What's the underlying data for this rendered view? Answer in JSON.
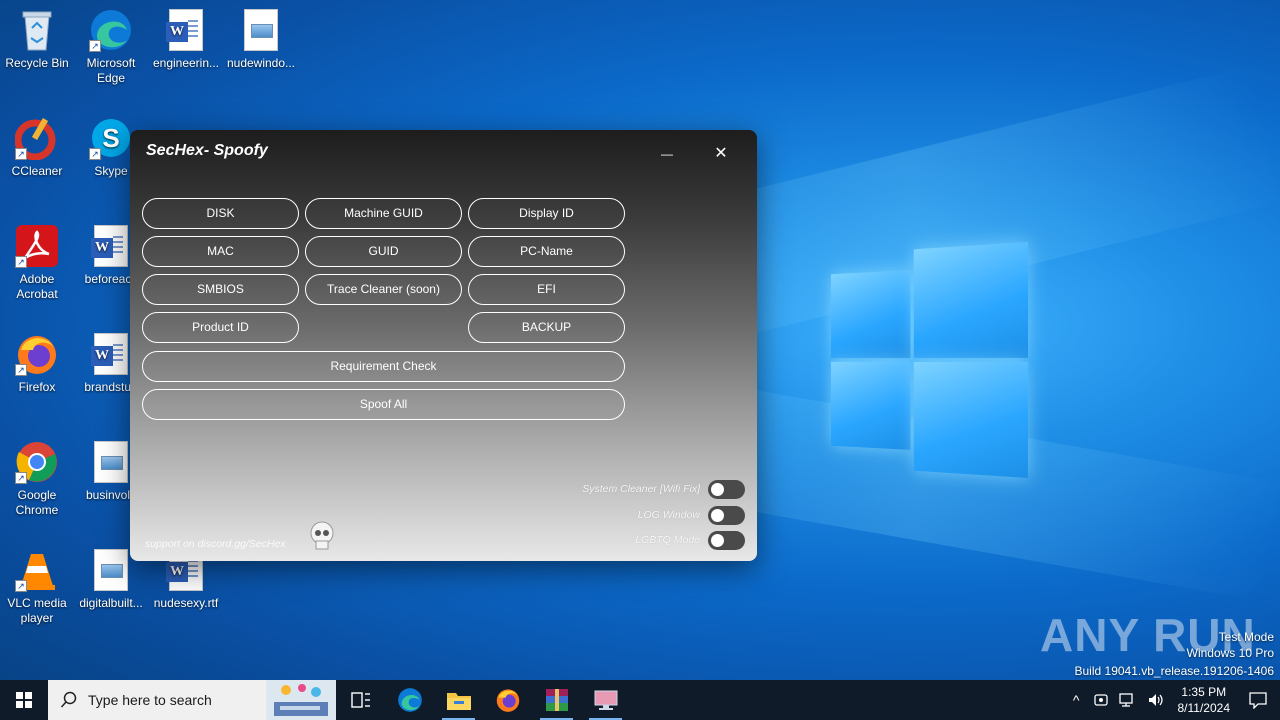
{
  "desktop": {
    "icons": [
      {
        "label": "Recycle Bin"
      },
      {
        "label": "Microsoft Edge"
      },
      {
        "label": "engineerin..."
      },
      {
        "label": "nudewindo..."
      },
      {
        "label": "CCleaner"
      },
      {
        "label": "Skype"
      },
      {
        "label": "Adobe Acrobat"
      },
      {
        "label": "beforeacc"
      },
      {
        "label": "Firefox"
      },
      {
        "label": "brandstud"
      },
      {
        "label": "Google Chrome"
      },
      {
        "label": "businvolv"
      },
      {
        "label": "VLC media player"
      },
      {
        "label": "digitalbuilt..."
      },
      {
        "label": "nudesexy.rtf"
      }
    ]
  },
  "app": {
    "title": "SecHex- Spoofy",
    "minimize_glyph": "—",
    "close_glyph": "✕",
    "buttons": {
      "disk": "DISK",
      "machine_guid": "Machine GUID",
      "display_id": "Display ID",
      "mac": "MAC",
      "guid": "GUID",
      "pc_name": "PC-Name",
      "smbios": "SMBIOS",
      "trace_cleaner": "Trace Cleaner (soon)",
      "efi": "EFI",
      "product_id": "Product ID",
      "backup": "BACKUP",
      "requirement_check": "Requirement Check",
      "spoof_all": "Spoof All"
    },
    "toggles": [
      {
        "label": "System Cleaner [Wifi Fix]",
        "on": false
      },
      {
        "label": "LOG Window",
        "on": false
      },
      {
        "label": "LGBTQ Mode",
        "on": false
      }
    ],
    "support_text": "support on discord.gg/SecHex"
  },
  "watermark": {
    "brand": "ANY RUN",
    "line1": "Test Mode",
    "line2": "Windows 10 Pro",
    "line3": "Build 19041.vb_release.191206-1406"
  },
  "taskbar": {
    "search_placeholder": "Type here to search",
    "time": "1:35 PM",
    "date": "8/11/2024"
  },
  "colors": {
    "wallpaper": "#0b69c9",
    "taskbar": "#101b2a",
    "app_dark": "#1d1d1d",
    "app_light": "#e8e8e8"
  }
}
